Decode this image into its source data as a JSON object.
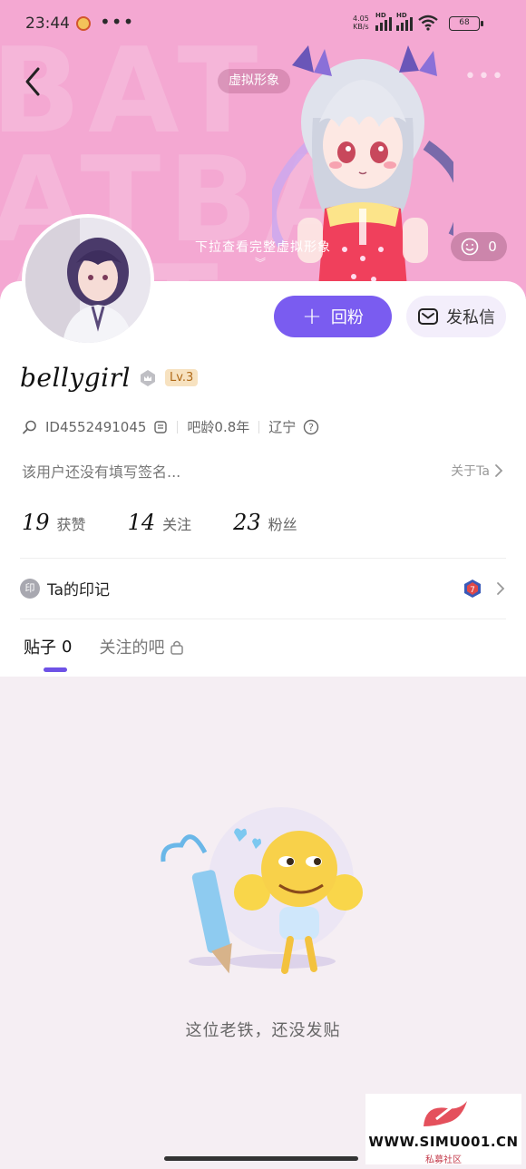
{
  "status_bar": {
    "time": "23:44",
    "more": "•••",
    "net_speed_value": "4.05",
    "net_speed_unit": "KB/s",
    "hd_label": "HD",
    "battery": "68"
  },
  "header": {
    "virtual_tag": "虚拟形象",
    "pull_hint": "下拉查看完整虚拟形象",
    "like_count": "0",
    "bg_letters": "BAT\nATBA\nA  T"
  },
  "profile": {
    "username": "bellygirl",
    "level": "Lv.3",
    "user_id": "ID4552491045",
    "bar_age": "吧龄0.8年",
    "region": "辽宁",
    "signature": "该用户还没有填写签名...",
    "about_label": "关于Ta"
  },
  "actions": {
    "follow_label": "回粉",
    "message_label": "发私信"
  },
  "stats": [
    {
      "num": "19",
      "label": "获赞"
    },
    {
      "num": "14",
      "label": "关注"
    },
    {
      "num": "23",
      "label": "粉丝"
    }
  ],
  "marks": {
    "icon_text": "印",
    "label": "Ta的印记"
  },
  "tabs": [
    {
      "label": "贴子",
      "count": "0"
    },
    {
      "label": "关注的吧"
    }
  ],
  "empty_state": {
    "text": "这位老铁，还没发贴"
  },
  "watermark": {
    "url": "WWW.SIMU001.CN",
    "sub": "私募社区"
  },
  "colors": {
    "header_bg": "#f4a8d2",
    "accent": "#7a5cf0",
    "level_badge": "#f7e2c0"
  }
}
